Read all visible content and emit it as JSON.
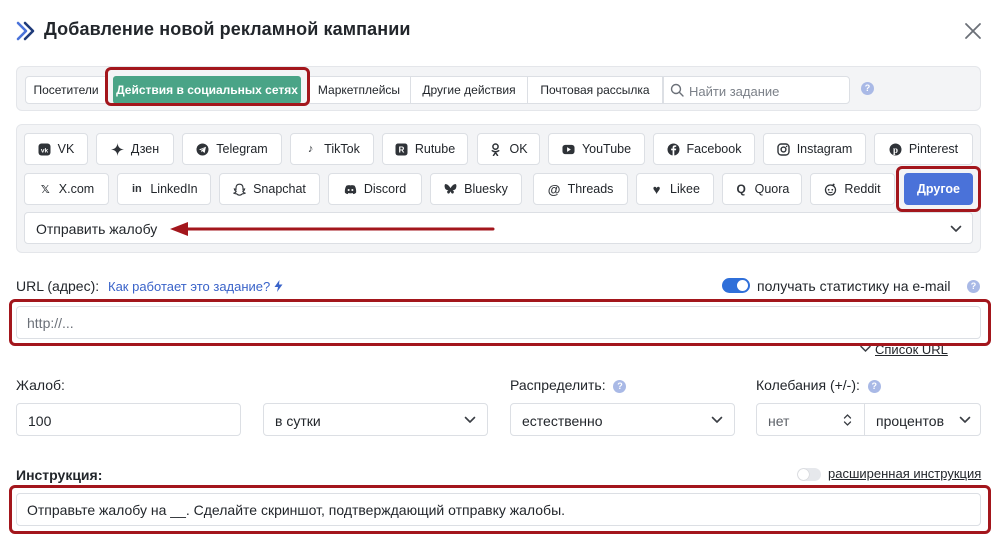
{
  "header": {
    "title": "Добавление новой рекламной кампании",
    "logo_icon": "double-chevron-right-icon",
    "close_icon": "close-icon"
  },
  "category_tabs": [
    {
      "label": "Посетители",
      "active": false
    },
    {
      "label": "Действия в социальных сетях",
      "active": true
    },
    {
      "label": "Маркетплейсы",
      "active": false
    },
    {
      "label": "Другие действия",
      "active": false
    },
    {
      "label": "Почтовая рассылка",
      "active": false
    }
  ],
  "search": {
    "placeholder": "Найти задание",
    "help": "?"
  },
  "networks_row1": [
    {
      "label": "VK",
      "icon": "vk-icon"
    },
    {
      "label": "Дзен",
      "icon": "dzen-icon"
    },
    {
      "label": "Telegram",
      "icon": "telegram-icon"
    },
    {
      "label": "TikTok",
      "icon": "tiktok-icon"
    },
    {
      "label": "Rutube",
      "icon": "rutube-icon"
    },
    {
      "label": "OK",
      "icon": "ok-icon"
    },
    {
      "label": "YouTube",
      "icon": "youtube-icon"
    },
    {
      "label": "Facebook",
      "icon": "facebook-icon"
    },
    {
      "label": "Instagram",
      "icon": "instagram-icon"
    },
    {
      "label": "Pinterest",
      "icon": "pinterest-icon"
    }
  ],
  "networks_row2": [
    {
      "label": "X.com",
      "icon": "x-icon"
    },
    {
      "label": "LinkedIn",
      "icon": "linkedin-icon"
    },
    {
      "label": "Snapchat",
      "icon": "snapchat-icon"
    },
    {
      "label": "Discord",
      "icon": "discord-icon"
    },
    {
      "label": "Bluesky",
      "icon": "bluesky-icon"
    },
    {
      "label": "Threads",
      "icon": "threads-icon"
    },
    {
      "label": "Likee",
      "icon": "likee-icon"
    },
    {
      "label": "Quora",
      "icon": "quora-icon"
    },
    {
      "label": "Reddit",
      "icon": "reddit-icon"
    },
    {
      "label": "Другое",
      "icon": "",
      "active": true
    }
  ],
  "action_select": {
    "value": "Отправить жалобу"
  },
  "url_section": {
    "label": "URL (адрес):",
    "how_link": "Как работает это задание?",
    "email_stats_label": "получать статистику на e-mail",
    "email_stats_enabled": true,
    "placeholder": "http://...",
    "list_link": "Список URL"
  },
  "complaints": {
    "label": "Жалоб:",
    "value": "100",
    "period": "в сутки"
  },
  "distribute": {
    "label": "Распределить:",
    "value": "естественно"
  },
  "fluctuation": {
    "label": "Колебания (+/-):",
    "value": "нет",
    "unit": "процентов"
  },
  "instruction": {
    "label": "Инструкция:",
    "extended_label": "расширенная инструкция",
    "extended_enabled": false,
    "text": "Отправьте жалобу на __. Сделайте скриншот, подтверждающий отправку жалобы."
  },
  "colors": {
    "active_tab": "#4aa487",
    "other_button": "#4a72d9",
    "annotation_red": "#a3161c",
    "link_blue": "#3a63c9"
  }
}
